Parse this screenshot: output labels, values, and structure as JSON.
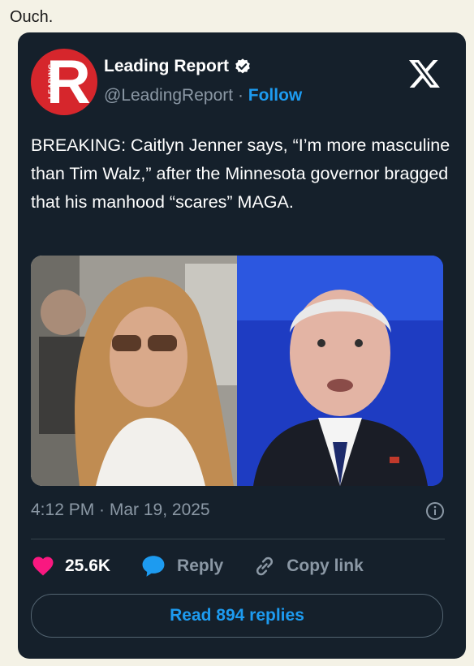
{
  "caption": "Ouch.",
  "tweet": {
    "author_name": "Leading Report",
    "handle": "@LeadingReport",
    "separator": "·",
    "follow_label": "Follow",
    "avatar_letter": "R",
    "avatar_mini": "LEADING",
    "text": "BREAKING: Caitlyn Jenner says, “I’m more masculine than Tim Walz,” after the Minnesota governor bragged that his manhood “scares” MAGA.",
    "timestamp": "4:12 PM · Mar 19, 2025",
    "likes": "25.6K",
    "reply_label": "Reply",
    "copy_link_label": "Copy link",
    "read_replies_label": "Read 894 replies"
  },
  "colors": {
    "card_bg": "#15202b",
    "accent": "#1d9bf0",
    "like": "#f91880",
    "muted": "#8b98a5",
    "brand_red": "#d6262c"
  },
  "icons": {
    "verified": "verified-badge-icon",
    "x_logo": "x-logo-icon",
    "info": "info-icon",
    "heart": "heart-icon",
    "reply": "reply-bubble-icon",
    "link": "link-icon"
  }
}
